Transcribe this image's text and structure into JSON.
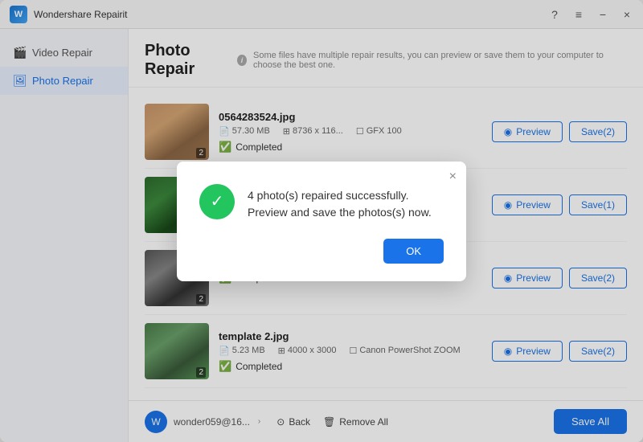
{
  "app": {
    "name": "Wondershare Repairit",
    "title": "Photo Repair",
    "subtitle": "Some files have multiple repair results, you can preview or save them to your computer to choose the best one."
  },
  "sidebar": {
    "items": [
      {
        "id": "video-repair",
        "label": "Video Repair",
        "icon": "🎬",
        "active": false
      },
      {
        "id": "photo-repair",
        "label": "Photo Repair",
        "icon": "🖼️",
        "active": true
      }
    ]
  },
  "photos": [
    {
      "id": 1,
      "name": "0564283524.jpg",
      "size": "57.30 MB",
      "dimensions": "8736 x 116...",
      "meta3": "GFX 100",
      "status": "Completed",
      "badge": "2",
      "preview_label": "Preview",
      "save_label": "Save(2)",
      "thumb_class": "thumb-1"
    },
    {
      "id": 2,
      "name": "",
      "size": "",
      "dimensions": "",
      "meta3": "",
      "status": "",
      "badge": "",
      "preview_label": "Preview",
      "save_label": "Save(1)",
      "thumb_class": "thumb-2"
    },
    {
      "id": 3,
      "name": "",
      "size": "",
      "dimensions": "",
      "meta3": "",
      "status": "Completed",
      "badge": "2",
      "preview_label": "Preview",
      "save_label": "Save(2)",
      "thumb_class": "thumb-3"
    },
    {
      "id": 4,
      "name": "template 2.jpg",
      "size": "5.23 MB",
      "dimensions": "4000 x 3000",
      "meta3": "Canon PowerShot ZOOM",
      "status": "Completed",
      "badge": "2",
      "preview_label": "Preview",
      "save_label": "Save(2)",
      "thumb_class": "thumb-4"
    }
  ],
  "modal": {
    "message": "4 photo(s) repaired successfully. Preview and save the photos(s) now.",
    "ok_label": "OK"
  },
  "footer": {
    "user": "wonder059@16...",
    "back_label": "Back",
    "remove_all_label": "Remove All",
    "save_all_label": "Save All"
  },
  "window_controls": {
    "help": "?",
    "menu": "≡",
    "minimize": "−",
    "close": "×"
  }
}
